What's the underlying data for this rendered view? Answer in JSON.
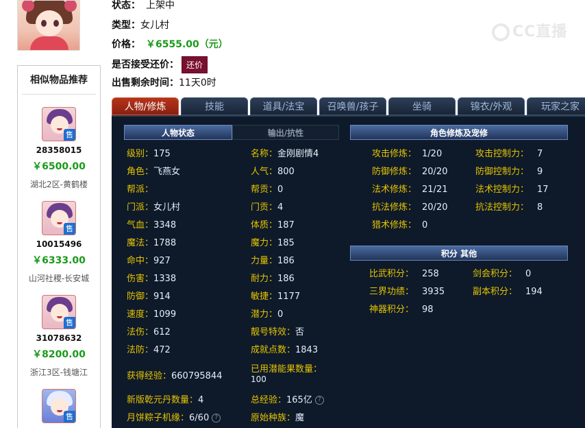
{
  "listing": {
    "status_label": "状态：",
    "status_value": "上架中",
    "type_label": "类型：",
    "type_value": "女儿村",
    "price_label": "价格：",
    "price_value": "￥6555.00（元）",
    "bargain_label": "是否接受还价：",
    "bargain_button": "还价",
    "remaining_label": "出售剩余时间：",
    "remaining_value": "11天0时"
  },
  "watermark": "CC直播",
  "similar": {
    "title": "相似物品推荐",
    "sell_tag": "售",
    "items": [
      {
        "id": "28358015",
        "price": "￥6500.00",
        "server": "湖北2区-黄鹤楼"
      },
      {
        "id": "10015496",
        "price": "￥6333.00",
        "server": "山河社稷-长安城"
      },
      {
        "id": "31078632",
        "price": "￥8200.00",
        "server": "浙江3区-钱塘江"
      },
      {
        "id": "",
        "price": "",
        "server": ""
      }
    ]
  },
  "tabs": [
    "人物/修炼",
    "技能",
    "道具/法宝",
    "召唤兽/孩子",
    "坐骑",
    "锦衣/外观",
    "玩家之家"
  ],
  "colors": {
    "price_green": "#1a9a1a",
    "label_yellow": "#e6c400",
    "active_tab": "#b4341a",
    "panel_bg": "#0e1a2a"
  },
  "char_panel": {
    "subtab_active": "人物状态",
    "subtab_inactive": "输出/抗性",
    "left_col": [
      {
        "k": "级别：",
        "v": "175"
      },
      {
        "k": "角色：",
        "v": "飞燕女"
      },
      {
        "k": "帮派：",
        "v": ""
      },
      {
        "k": "门派：",
        "v": "女儿村"
      },
      {
        "k": "气血：",
        "v": "3348"
      },
      {
        "k": "魔法：",
        "v": "1788"
      },
      {
        "k": "命中：",
        "v": "927"
      },
      {
        "k": "伤害：",
        "v": "1338"
      },
      {
        "k": "防御：",
        "v": "914"
      },
      {
        "k": "速度：",
        "v": "1099"
      },
      {
        "k": "法伤：",
        "v": "612"
      },
      {
        "k": "法防：",
        "v": "472"
      }
    ],
    "right_col": [
      {
        "k": "名称：",
        "v": "金刚剧情4"
      },
      {
        "k": "人气：",
        "v": "800"
      },
      {
        "k": "帮贡：",
        "v": "0"
      },
      {
        "k": "门贡：",
        "v": "4"
      },
      {
        "k": "体质：",
        "v": "187"
      },
      {
        "k": "魔力：",
        "v": "185"
      },
      {
        "k": "力量：",
        "v": "186"
      },
      {
        "k": "耐力：",
        "v": "186"
      },
      {
        "k": "敏捷：",
        "v": "1177"
      },
      {
        "k": "潜力：",
        "v": "0"
      },
      {
        "k": "靓号特效：",
        "v": "否"
      },
      {
        "k": "成就点数：",
        "v": "1843"
      }
    ],
    "exp": {
      "k": "获得经验：",
      "v": "660795844"
    },
    "used_fruit": {
      "k": "已用潜能果数量：",
      "v": "100"
    },
    "qianyuan": {
      "k": "新版乾元丹数量：",
      "v": "4"
    },
    "total_exp": {
      "k": "总经验：",
      "v": "165亿"
    },
    "mooncake": {
      "k": "月饼粽子机缘：",
      "v": "6/60"
    },
    "origin_race": {
      "k": "原始种族：",
      "v": "魔"
    }
  },
  "cultivation": {
    "title": "角色修炼及宠修",
    "left": [
      {
        "k": "攻击修炼：",
        "v": "1/20"
      },
      {
        "k": "防御修炼：",
        "v": "20/20"
      },
      {
        "k": "法术修炼：",
        "v": "21/21"
      },
      {
        "k": "抗法修炼：",
        "v": "20/20"
      },
      {
        "k": "猎术修炼：",
        "v": "0"
      }
    ],
    "right": [
      {
        "k": "攻击控制力：",
        "v": "7"
      },
      {
        "k": "防御控制力：",
        "v": "9"
      },
      {
        "k": "法术控制力：",
        "v": "17"
      },
      {
        "k": "抗法控制力：",
        "v": "8"
      }
    ]
  },
  "points": {
    "title": "积分 其他",
    "left": [
      {
        "k": "比武积分：",
        "v": "258"
      },
      {
        "k": "三界功绩：",
        "v": "3935"
      },
      {
        "k": "神器积分：",
        "v": "98"
      }
    ],
    "right": [
      {
        "k": "剑会积分：",
        "v": "0"
      },
      {
        "k": "副本积分：",
        "v": "194"
      }
    ]
  },
  "help_glyph": "?"
}
